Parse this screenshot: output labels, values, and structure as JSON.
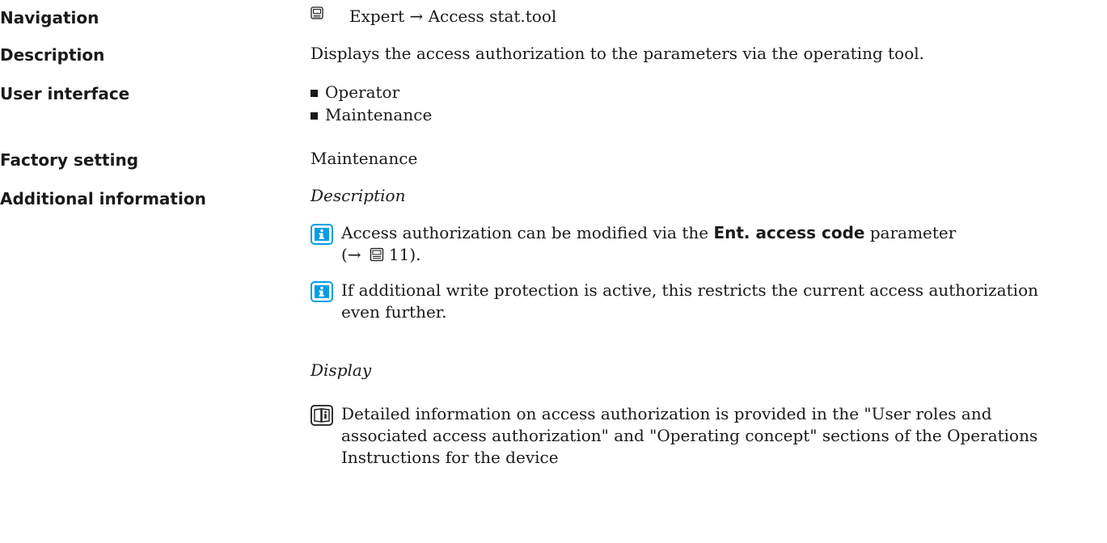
{
  "navigation": {
    "label": "Navigation",
    "icon": "display-icon",
    "path": "Expert → Access stat.tool"
  },
  "description": {
    "label": "Description",
    "text": "Displays the access authorization to the parameters via the operating tool."
  },
  "user_interface": {
    "label": "User interface",
    "options": [
      "Operator",
      "Maintenance"
    ]
  },
  "factory_setting": {
    "label": "Factory setting",
    "value": "Maintenance"
  },
  "additional_information": {
    "label": "Additional information",
    "description_heading": "Description",
    "note1": {
      "icon": "info-icon",
      "text_before": "Access authorization can be modified via the ",
      "bold": "Ent. access code",
      "text_after": " parameter",
      "line2": "(→ 11).",
      "ref_prefix": "(→ ",
      "ref_page": "11",
      "ref_suffix": ")."
    },
    "note2": {
      "icon": "info-icon",
      "line1": "If additional write protection is active, this restricts the current access authorization",
      "line2": "even further."
    },
    "display_heading": "Display",
    "note3": {
      "icon": "book-icon",
      "line1": "Detailed information on access authorization is provided in the \"User roles and",
      "line2": "associated access authorization\" and \"Operating concept\" sections of the Operations",
      "line3": "Instructions for the device"
    }
  },
  "colors": {
    "info_blue": "#009ee3",
    "text": "#1a1a1a"
  }
}
